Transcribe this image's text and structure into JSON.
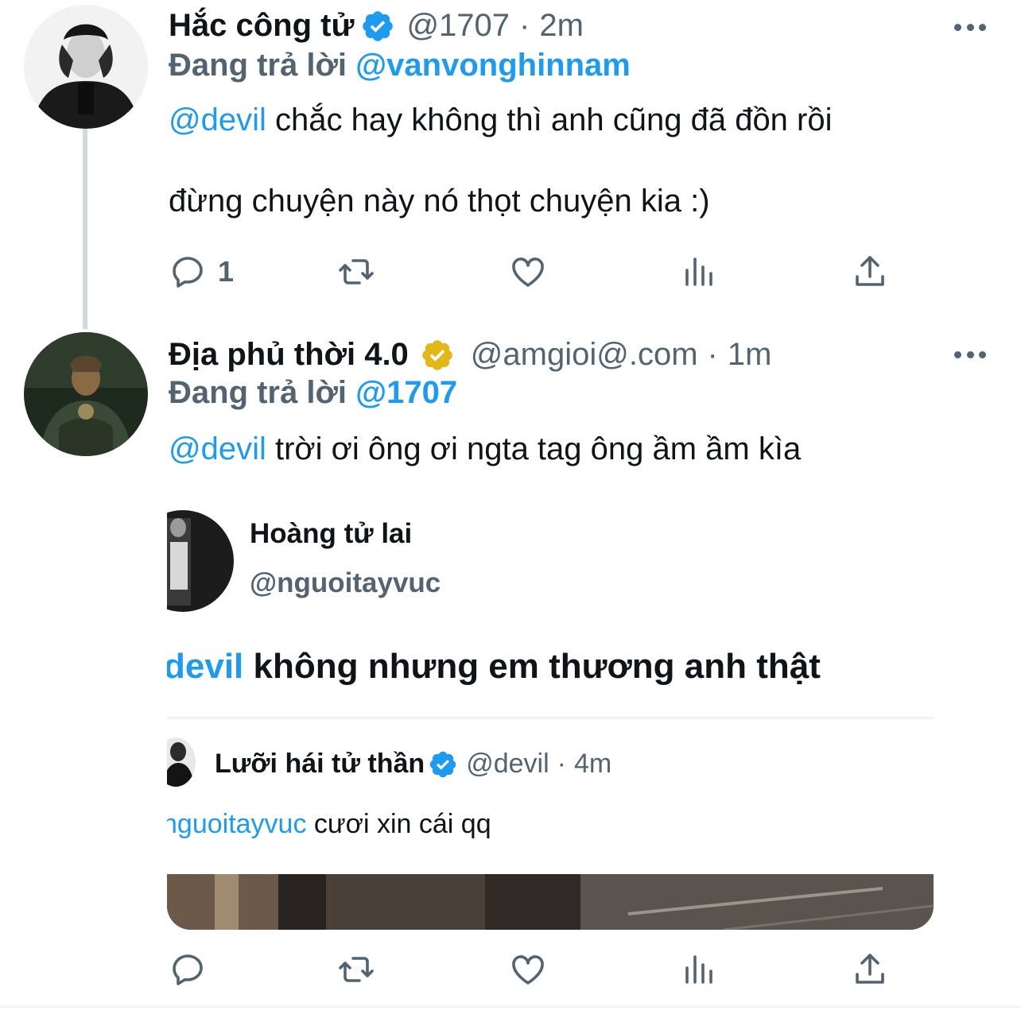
{
  "colors": {
    "accent": "#1d9bf0",
    "text_primary": "#0f1419",
    "text_secondary": "#536471",
    "verified_blue": "#1d9bf0",
    "verified_gold": "#e2b719"
  },
  "tweets": [
    {
      "avatar_icon": "user-avatar",
      "display_name": "Hắc công tử",
      "verified_badge": "blue-verified-icon",
      "handle": "@1707",
      "separator": "·",
      "time": "2m",
      "reply_label": "Đang trả lời",
      "reply_to": "@vanvonghinnam",
      "mention": "@devil",
      "text_line1": " chắc hay không thì anh cũng đã đồn rồi",
      "text_line2": "đừng chuyện này nó thọt chuyện kia :)",
      "actions": {
        "reply_count": "1",
        "retweet_count": "",
        "like_count": ""
      }
    },
    {
      "avatar_icon": "user-avatar",
      "display_name": "Địa phủ thời 4.0",
      "verified_badge": "gold-verified-icon",
      "handle": "@amgioi@.com",
      "separator": "·",
      "time": "1m",
      "reply_label": "Đang trả lời",
      "reply_to": "@1707",
      "mention": "@devil",
      "text_line1": " trời ơi ông ơi ngta tag ông ầm ầm kìa",
      "embedded_image": {
        "name": "Hoàng tử lai",
        "handle": "@nguoitayvuc",
        "mention": "devil",
        "text": " không nhưng em thương anh thật",
        "quoted": {
          "name": "Lưỡi hái tử thần",
          "handle": "@devil",
          "separator": "·",
          "time": "4m",
          "mention": "nguoitayvuc",
          "text": " cươi xin cái qq"
        }
      }
    }
  ]
}
